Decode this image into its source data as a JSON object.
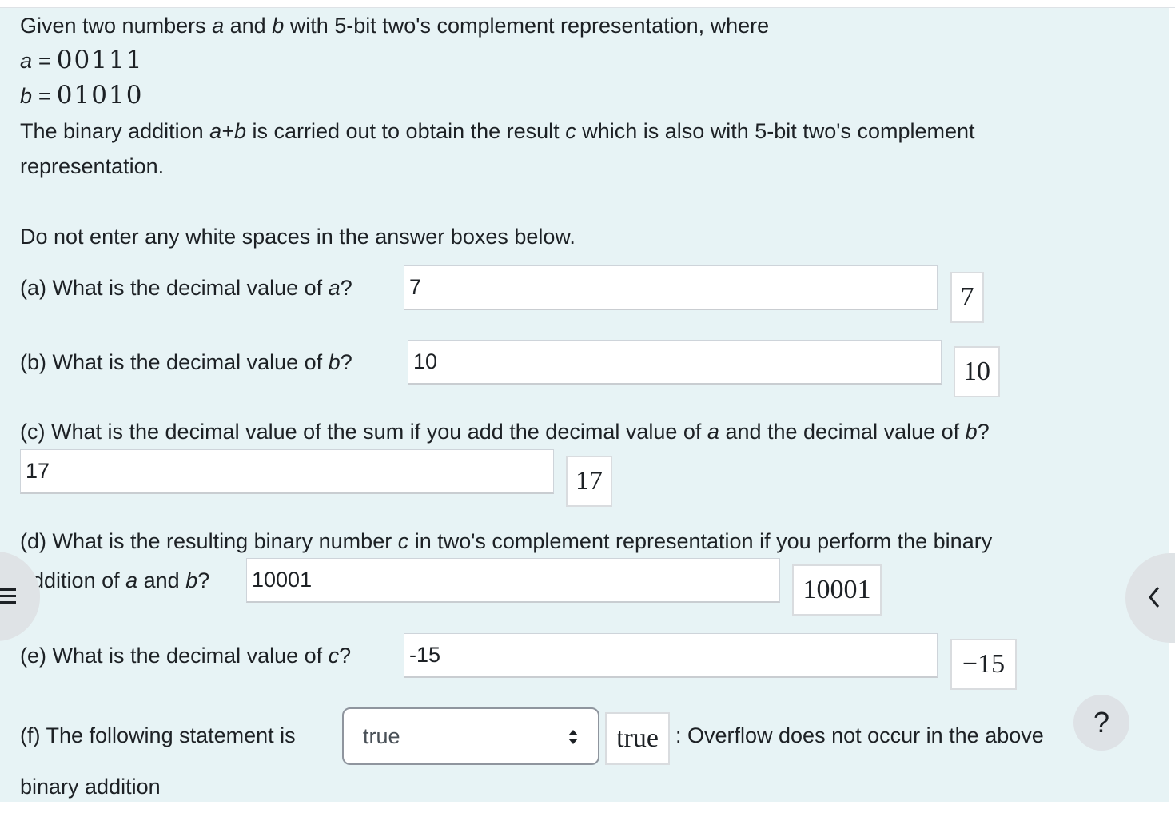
{
  "intro": {
    "line1_pre": "Given two numbers ",
    "var_a": "a",
    "line1_mid": " and ",
    "var_b": "b",
    "line1_post": " with 5-bit two's complement representation, where",
    "a_eq": "a = ",
    "a_bits": "00111",
    "b_eq": "b = ",
    "b_bits": "01010",
    "line4_pre": "The binary addition ",
    "line4_expr": "a+b",
    "line4_mid": " is carried out to obtain the result ",
    "var_c": "c",
    "line4_post": " which is also with 5-bit two's complement",
    "line5": "representation."
  },
  "instruction": "Do not enter any white spaces in the answer boxes below.",
  "questions": {
    "a": {
      "pre": "(a) What is the decimal value of ",
      "var": "a",
      "post": "?",
      "value": "7",
      "preview": "7"
    },
    "b": {
      "pre": "(b) What is the decimal value of ",
      "var": "b",
      "post": "?",
      "value": "10",
      "preview": "10"
    },
    "c": {
      "pre": "(c) What is the decimal value of the sum if you add the decimal value of ",
      "var1": "a",
      "mid": " and the decimal value of ",
      "var2": "b",
      "post": "?",
      "value": "17",
      "preview": "17"
    },
    "d": {
      "line1_pre": "(d) What is the resulting binary number ",
      "var_c": "c",
      "line1_post": " in two's complement representation if you perform the binary",
      "line2_pre": "addition of ",
      "var_a": "a",
      "line2_mid": " and ",
      "var_b": "b",
      "line2_post": "?",
      "value": "10001",
      "preview": "10001"
    },
    "e": {
      "pre": "(e) What is the decimal value of ",
      "var": "c",
      "post": "?",
      "value": "-15",
      "preview": "−15"
    },
    "f": {
      "pre": "(f) The following statement is",
      "selected": "true",
      "preview": "true",
      "post": ": Overflow does not occur in the above",
      "line2": "binary addition"
    }
  },
  "controls": {
    "help_label": "?"
  },
  "icons": {
    "drawer": "hamburger-menu-icon",
    "right_drawer": "chevron-left-icon",
    "select": "select-arrows-icon"
  }
}
